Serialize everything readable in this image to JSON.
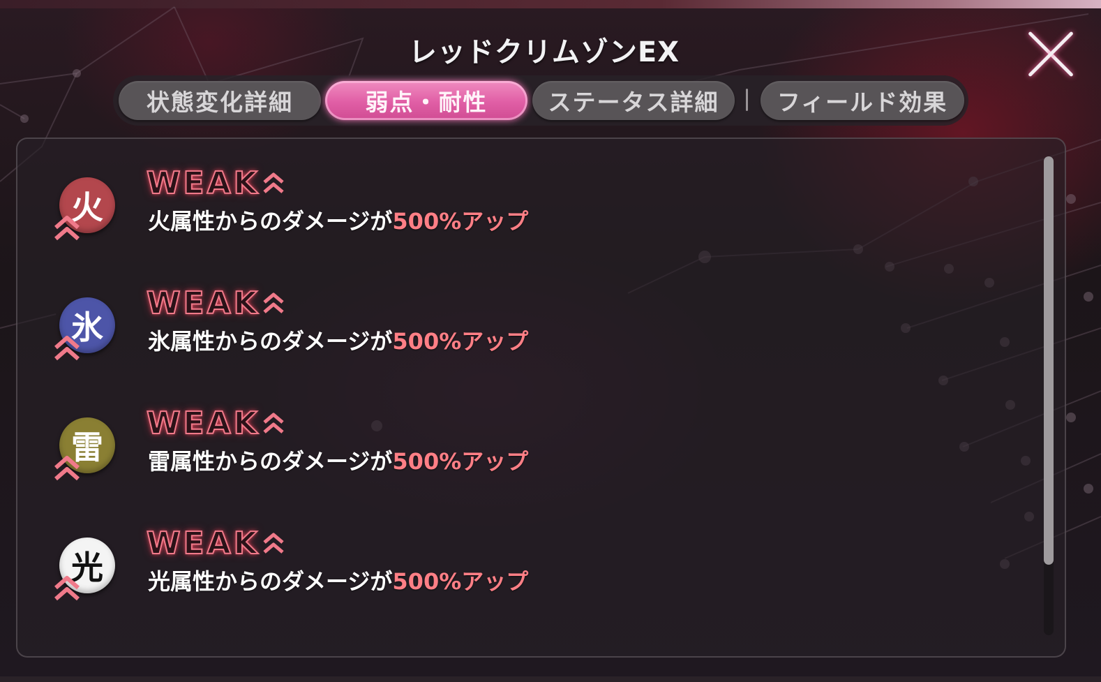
{
  "window": {
    "title": "レッドクリムゾンEX"
  },
  "tabs": [
    {
      "label": "状態変化詳細",
      "active": false
    },
    {
      "label": "弱点・耐性",
      "active": true
    },
    {
      "label": "ステータス詳細",
      "active": false
    },
    {
      "label": "フィールド効果",
      "active": false
    }
  ],
  "weaknesses": [
    {
      "element": "火",
      "color": "#b3474d",
      "badge": "WEAK",
      "desc_prefix": "火属性からのダメージが",
      "amount": "500%アップ"
    },
    {
      "element": "氷",
      "color": "#4d55a8",
      "badge": "WEAK",
      "desc_prefix": "氷属性からのダメージが",
      "amount": "500%アップ"
    },
    {
      "element": "雷",
      "color": "#8a7f33",
      "badge": "WEAK",
      "desc_prefix": "雷属性からのダメージが",
      "amount": "500%アップ"
    },
    {
      "element": "光",
      "color": "#f4f4f4",
      "badge": "WEAK",
      "desc_prefix": "光属性からのダメージが",
      "amount": "500%アップ"
    }
  ],
  "colors": {
    "accent_pink": "#e05ea5",
    "weak_red": "#f07a8a",
    "amount_red": "#ff7f86"
  },
  "icons": {
    "close": "close-icon",
    "up": "double-chevron-up-icon"
  }
}
